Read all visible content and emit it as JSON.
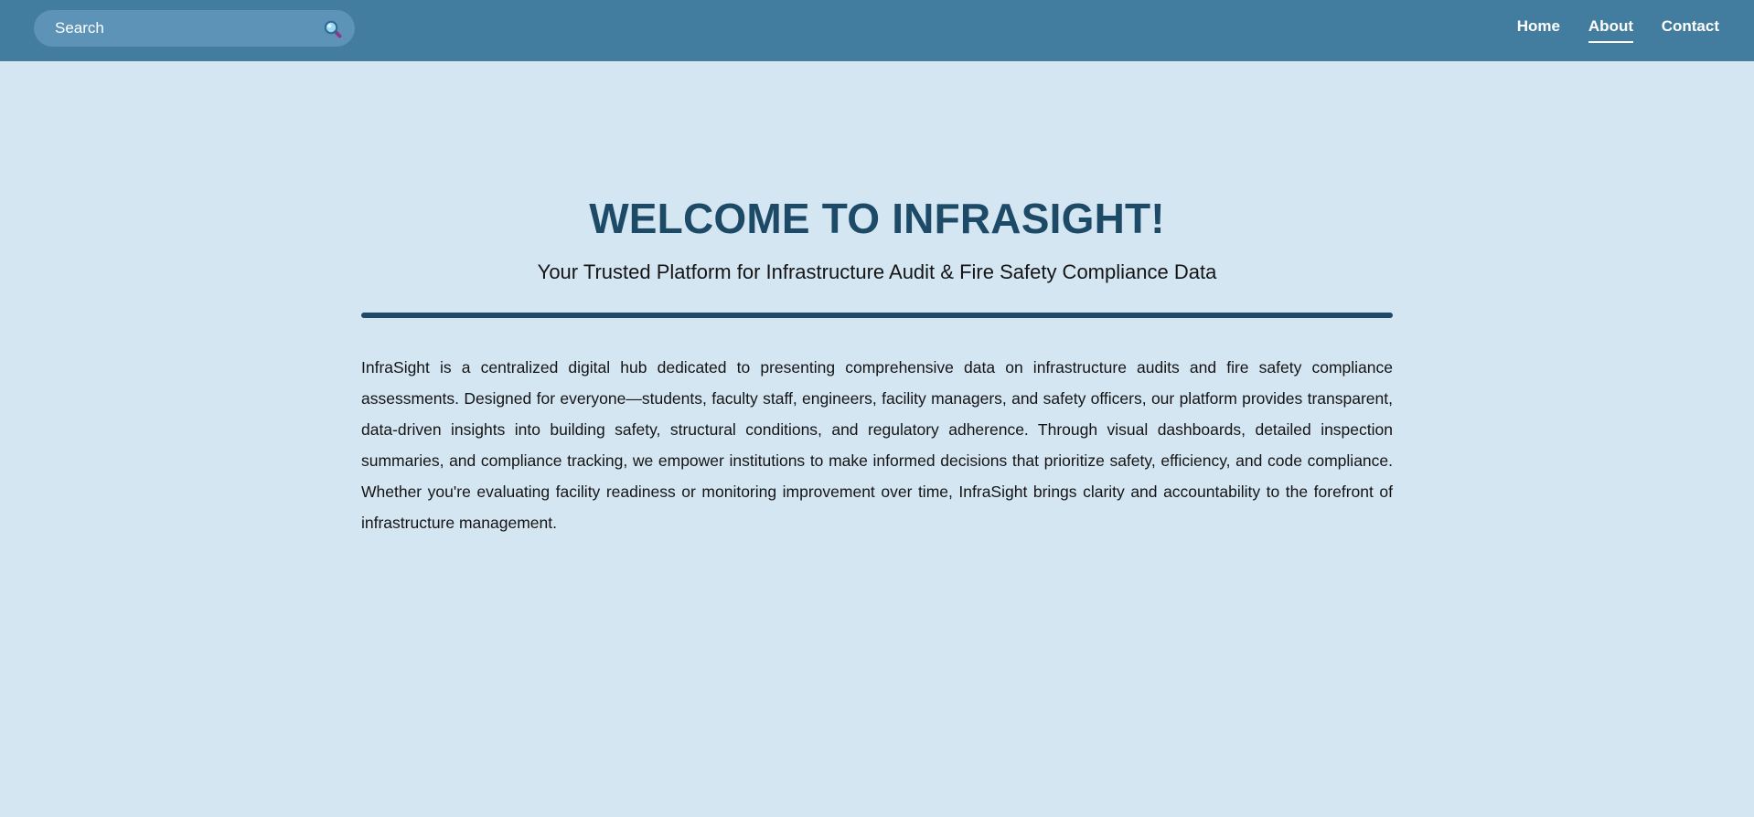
{
  "header": {
    "search": {
      "placeholder": "Search",
      "icon": "search-icon"
    },
    "nav": [
      {
        "label": "Home",
        "active": false
      },
      {
        "label": "About",
        "active": true
      },
      {
        "label": "Contact",
        "active": false
      }
    ],
    "colors": {
      "bar": "#427c9e",
      "search_bg": "#5c93b7",
      "nav_text": "#ffffff"
    }
  },
  "hero": {
    "title": "WELCOME TO INFRASIGHT!",
    "subtitle": "Your Trusted Platform for Infrastructure Audit & Fire Safety Compliance Data",
    "body": "InfraSight is a centralized digital hub dedicated to presenting comprehensive data on infrastructure audits and fire safety compliance assessments. Designed for everyone—students, faculty staff, engineers, facility managers, and safety officers, our platform provides transparent, data-driven insights into building safety, structural conditions, and regulatory adherence. Through visual dashboards, detailed inspection summaries, and compliance tracking, we empower institutions to make informed decisions that prioritize safety, efficiency, and code compliance. Whether you're evaluating facility readiness or monitoring improvement over time, InfraSight brings clarity and accountability to the forefront of infrastructure management."
  },
  "colors": {
    "page_bg": "#d5e6f3",
    "title": "#1d4a66",
    "divider": "#1d4a66",
    "body_text": "#141414"
  }
}
